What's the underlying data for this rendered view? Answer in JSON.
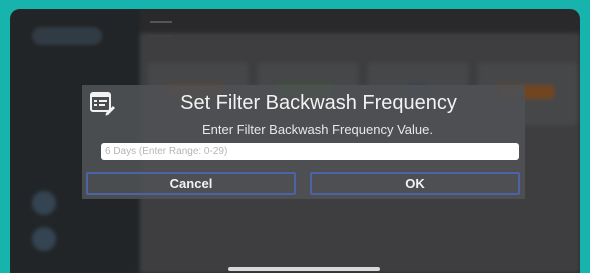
{
  "dialog": {
    "title": "Set Filter Backwash Frequency",
    "message": "Enter Filter Backwash Frequency Value.",
    "input_value": "",
    "input_placeholder": "6 Days (Enter Range: 0-29)",
    "cancel_label": "Cancel",
    "ok_label": "OK",
    "icon": "edit-list-icon"
  },
  "colors": {
    "frame": "#17b3ad",
    "button_border": "#4c63a8",
    "dialog_bg": "#4e5054"
  }
}
